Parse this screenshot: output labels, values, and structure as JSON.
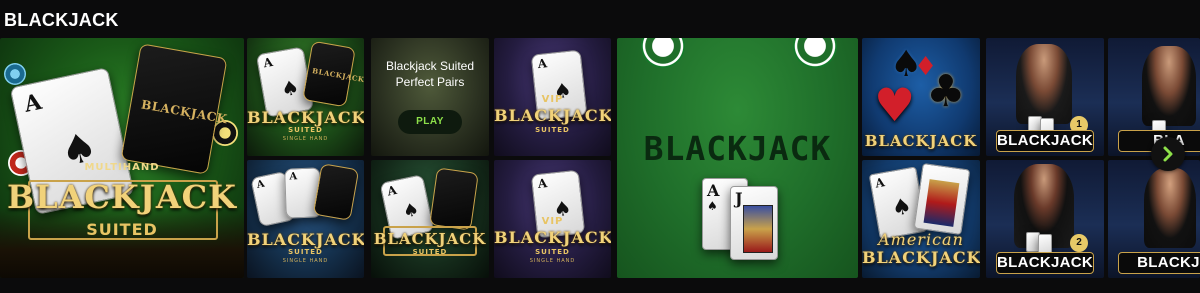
{
  "section": {
    "title": "BLACKJACK"
  },
  "tiles": {
    "multihand": {
      "top_label": "MULTIHAND",
      "main_label": "BLACKJACK",
      "sub_label": "SUITED",
      "card_logo": "BLACKJACK"
    },
    "suited_single_1": {
      "main_label": "BLACKJACK",
      "sub_label": "SUITED",
      "tiny_label": "SINGLE HAND",
      "card_logo": "BLACKJACK"
    },
    "suited_perfect_pairs": {
      "title_line1": "Blackjack Suited",
      "title_line2": "Perfect Pairs",
      "play_label": "PLAY"
    },
    "vip_1": {
      "badge": "VIP",
      "main_label": "BLACKJACK",
      "sub_label": "SUITED"
    },
    "suited_single_2": {
      "main_label": "BLACKJACK",
      "sub_label": "SUITED",
      "tiny_label": "SINGLE HAND"
    },
    "suited_3": {
      "main_label": "BLACKJACK",
      "sub_label": "SUITED"
    },
    "vip_2": {
      "badge": "VIP",
      "main_label": "BLACKJACK",
      "sub_label": "SUITED",
      "tiny_label": "SINGLE HAND"
    },
    "table": {
      "main_label": "BLACKJACK",
      "card1_rank": "A",
      "card2_rank": "J"
    },
    "classic": {
      "main_label": "BLACKJACK"
    },
    "american": {
      "top_label": "American",
      "main_label": "BLACKJACK"
    },
    "live_1": {
      "label": "BLACKJACK",
      "number": "1"
    },
    "live_2": {
      "label": "BLACKJACK",
      "number": "2"
    },
    "live_3": {
      "label": "BLA"
    },
    "live_4": {
      "label": "BLACKJA"
    }
  },
  "navigation": {
    "next_icon": "chevron-right-icon"
  },
  "colors": {
    "accent_green": "#8de04a",
    "gold": "#c9a24a",
    "background": "#0b0b0c"
  }
}
